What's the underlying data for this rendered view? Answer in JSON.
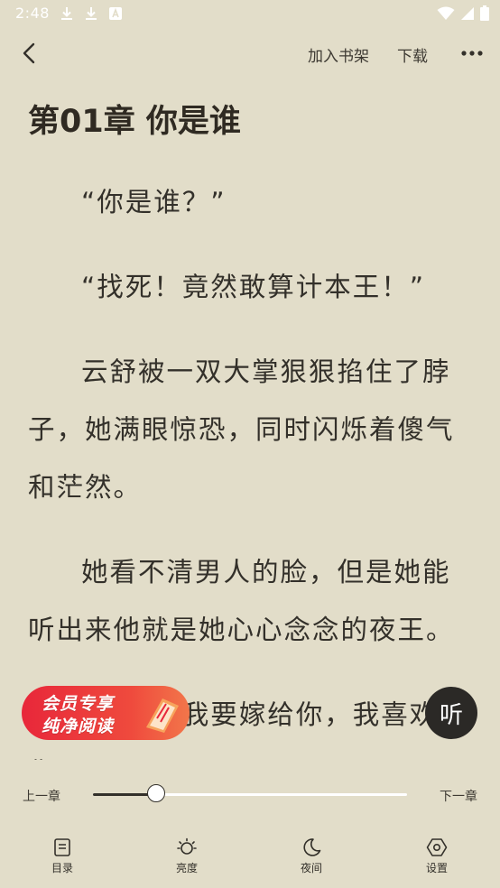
{
  "status_bar": {
    "time": "2:48",
    "icons": [
      "download-icon",
      "download-icon",
      "font-icon",
      "wifi-icon",
      "signal-icon",
      "battery-icon"
    ]
  },
  "top_bar": {
    "add_to_shelf": "加入书架",
    "download": "下载",
    "more_icon": "more-icon"
  },
  "chapter": {
    "title": "第01章 你是谁",
    "paragraphs": [
      "“你是谁？”",
      "“找死！竟然敢算计本王！”",
      "云舒被一双大掌狠狠掐住了脖子，她满眼惊恐，同时闪烁着傻气和茫然。",
      "她看不清男人的脸，但是她能听出来他就是她心心念念的夜王。",
      "“王……我要嫁给你，我喜欢你……”"
    ]
  },
  "vip_badge": {
    "line1": "会员专享",
    "line2": "纯净阅读"
  },
  "listen_button": {
    "label": "听"
  },
  "progress": {
    "prev_label": "上一章",
    "next_label": "下一章",
    "value_fraction": 0.2
  },
  "bottom_nav": [
    {
      "label": "目录",
      "icon": "catalog-icon"
    },
    {
      "label": "亮度",
      "icon": "brightness-icon"
    },
    {
      "label": "夜间",
      "icon": "moon-icon"
    },
    {
      "label": "设置",
      "icon": "settings-icon"
    }
  ],
  "colors": {
    "background": "#e2ddc9",
    "text": "#33302a",
    "vip_red": "#e8273a",
    "listen_bg": "#2b2926"
  }
}
